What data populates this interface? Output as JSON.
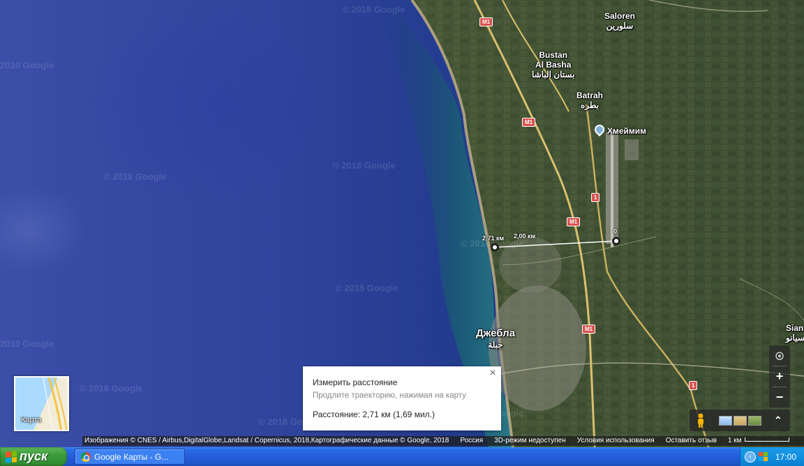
{
  "watermarks": [
    "© 2018 Google",
    "2010 Google",
    "© 2018 Google",
    "© 2018 Google",
    "© 2018 Google",
    "© 2018 Google",
    "2010 Google",
    "© 2018 Google",
    "© 2018 Google",
    "© 2018 Google"
  ],
  "places": {
    "saloren": {
      "name": "Saloren",
      "ar": "سلورين"
    },
    "bustan": {
      "name": "Bustan\nAl Basha",
      "ar": "بستان الباشا"
    },
    "batrah": {
      "name": "Batrah",
      "ar": "بطره"
    },
    "khmeimim": {
      "name": "Хмеймим"
    },
    "jableh": {
      "name": "Джебла",
      "ar": "جبلة"
    },
    "sian": {
      "name": "Sian",
      "ar": "سيانو"
    }
  },
  "roads": {
    "m1": "M1",
    "one": "1"
  },
  "measurement": {
    "label_total": "2,71 км",
    "label_segment": "2,00 км",
    "label_end": "0"
  },
  "minimap": {
    "label": "Карта"
  },
  "popup": {
    "title": "Измерить расстояние",
    "hint": "Продлите траекторию, нажимая на карту",
    "distance": "Расстояние: 2,71 км (1,69 мил.)",
    "close": "×"
  },
  "controls": {
    "zoom_in": "+",
    "zoom_out": "−",
    "collapse": "⌃"
  },
  "attribution": {
    "imagery": "Изображения © CNES / Airbus,DigitalGlobe,Landsat / Copernicus, 2018,Картографические данные © Google, 2018",
    "country": "Россия",
    "mode3d": "3D-режим недоступен",
    "terms": "Условия использования",
    "feedback": "Оставить отзыв",
    "scale": "1 км"
  },
  "taskbar": {
    "start_label": "пуск",
    "task_label": "Google Карты - G...",
    "clock": "17:00"
  },
  "colors": {
    "road_badge": "#d9534f",
    "taskbar": "#245edb",
    "start": "#3c9c3c"
  }
}
